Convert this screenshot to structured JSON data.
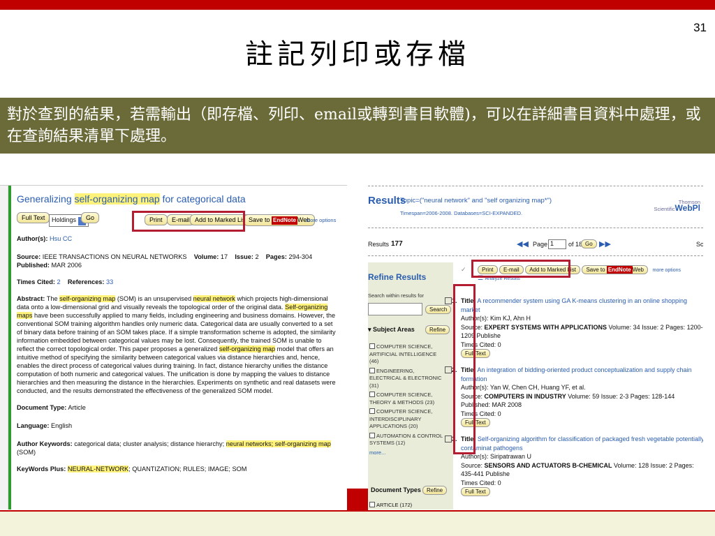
{
  "slide": {
    "number": "31",
    "title": "註記列印或存檔",
    "description": "對於查到的結果，若需輸出（即存檔、列印、email或轉到書目軟體)，可以在詳細書目資料中處理，或在查詢結果清單下處理。"
  },
  "left": {
    "title_pre": "Generalizing ",
    "title_hl": "self-organizing map",
    "title_post": " for categorical data",
    "buttons": {
      "full_text": "Full Text",
      "holdings": "Holdings",
      "go": "Go",
      "print": "Print",
      "email": "E-mail",
      "add_marked": "Add to Marked List",
      "save_to": "Save to",
      "endnote": "EndNote",
      "web": "Web",
      "more_options": "more options"
    },
    "authors_label": "Author(s):",
    "authors": "Hsu CC",
    "source_label": "Source:",
    "source": "IEEE TRANSACTIONS ON NEURAL NETWORKS",
    "volume_label": "Volume:",
    "volume": "17",
    "issue_label": "Issue:",
    "issue": "2",
    "pages_label": "Pages:",
    "pages": "294-304",
    "published_label": "Published:",
    "published": "MAR 2006",
    "times_cited_label": "Times Cited:",
    "times_cited": "2",
    "references_label": "References:",
    "references": "33",
    "abstract_label": "Abstract:",
    "abstract_p1": "The ",
    "abstract_h1": "self-organizing map",
    "abstract_p2": " (SOM) is an unsupervised ",
    "abstract_h2": "neural network",
    "abstract_p3": " which projects high-dimensional data onto a low-dimensional grid and visually reveals the topological order of the original data. ",
    "abstract_h3": "Self-organizing maps",
    "abstract_p4": " have been successfully applied to many fields, including engineering and business domains. However, the conventional SOM training algorithm handles only numeric data. Categorical data are usually converted to a set of binary data before training of an SOM takes place. If a simple transformation scheme is adopted, the similarity information embedded between categorical values may be lost. Consequently, the trained SOM is unable to reflect the correct topological order. This paper proposes a generalized ",
    "abstract_h4": "self-organizing map",
    "abstract_p5": " model that offers an intuitive method of specifying the similarity between categorical values via distance hierarchies and, hence, enables the direct process of categorical values during training. In fact, distance hierarchy unifies the distance computation of both numeric and categorical values. The unification is done by mapping the values to distance hierarchies and then measuring the distance in the hierarchies. Experiments on synthetic and real datasets were conducted, and the results demonstrated the effectiveness of the generalized SOM model.",
    "doctype_label": "Document Type:",
    "doctype": "Article",
    "language_label": "Language:",
    "language": "English",
    "author_kw_label": "Author Keywords:",
    "author_kw_p": "categorical data; cluster analysis; distance hierarchy; ",
    "author_kw_h": "neural networks; self-organizing map",
    "author_kw_tail": " (SOM)",
    "kwplus_label": "KeyWords Plus:",
    "kwplus_h": "NEURAL-NETWORK",
    "kwplus_tail": "; QUANTIZATION; RULES; IMAGE; SOM"
  },
  "right": {
    "results_title": "Results",
    "topic": "Topic=(\"neural network\" and \"self organizing map*\")",
    "timespan": "Timespan=2006-2008. Databases=SCI-EXPANDED.",
    "thomson_line1": "Thomson",
    "thomson_line2": "Scientific",
    "thomson_brand": "WebPl",
    "results_label": "Results",
    "results_count": "177",
    "page_label": "Page",
    "page_value": "1",
    "of_pages": "of 18",
    "go": "Go",
    "sort_fragment": "Sc",
    "refine_title": "Refine Results",
    "search_within": "Search within results for",
    "search_btn": "Search",
    "subject_areas": "Subject Areas",
    "refine_btn": "Refine",
    "subjects": [
      "COMPUTER SCIENCE, ARTIFICIAL INTELLIGENCE (46)",
      "ENGINEERING, ELECTRICAL & ELECTRONIC (31)",
      "COMPUTER SCIENCE, THEORY & METHODS (23)",
      "COMPUTER SCIENCE, INTERDISCIPLINARY APPLICATIONS (20)",
      "AUTOMATION & CONTROL SYSTEMS (12)"
    ],
    "more": "more...",
    "doc_types": "Document Types",
    "article": "ARTICLE (172)",
    "print": "Print",
    "email": "E-mail",
    "add_marked": "Add to Marked List",
    "save_to": "Save to",
    "endnote": "EndNote",
    "web": "Web",
    "more_options": "more options",
    "analyze": "Analyze Results",
    "records": [
      {
        "num": "1.",
        "title": "A recommender system using GA K-means clustering in an online shopping market",
        "authors": "Author(s): Kim KJ, Ahn H",
        "source_pre": "Source: ",
        "source": "EXPERT SYSTEMS WITH APPLICATIONS",
        "source_tail": "  Volume: 34  Issue: 2  Pages: 1200-1209  Publishe",
        "cited": "Times Cited: 0",
        "full_text": "Full Text"
      },
      {
        "num": "2.",
        "title": "An integration of bidding-oriented product conceptualization and supply chain formation",
        "authors": "Author(s): Yan W, Chen CH, Huang YF, et al.",
        "source_pre": "Source: ",
        "source": "COMPUTERS IN INDUSTRY",
        "source_tail": "  Volume: 59  Issue: 2-3  Pages: 128-144  Published: MAR 2008",
        "cited": "Times Cited: 0",
        "full_text": "Full Text"
      },
      {
        "num": "3.",
        "title": "Self-organizing algorithm for classification of packaged fresh vegetable potentially contaminat pathogens",
        "authors": "Author(s): Siripatrawan U",
        "source_pre": "Source: ",
        "source": "SENSORS AND ACTUATORS B-CHEMICAL",
        "source_tail": "  Volume: 128  Issue: 2  Pages: 435-441  Publishe",
        "cited": "Times Cited: 0",
        "full_text": "Full Text"
      }
    ]
  },
  "colors": {
    "brand_red": "#c00000",
    "desc_bg": "#6b6b3a",
    "highlight": "#fff27a",
    "link_blue": "#2a5db0"
  }
}
